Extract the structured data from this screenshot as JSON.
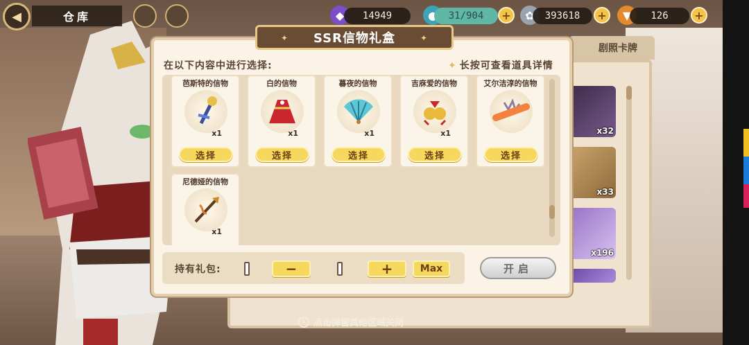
{
  "header": {
    "title": "仓库",
    "resources": [
      {
        "name": "crystal",
        "value": "14949",
        "icon": "crystal-icon"
      },
      {
        "name": "stamina",
        "value": "31/904",
        "icon": "potion-icon"
      },
      {
        "name": "coins",
        "value": "393618",
        "icon": "coin-icon"
      },
      {
        "name": "carrot",
        "value": "126",
        "icon": "carrot-icon"
      }
    ]
  },
  "side_panel": {
    "tab_label": "剧照卡牌",
    "items": [
      {
        "count": "x32"
      },
      {
        "count": "x33"
      },
      {
        "count": "x196"
      }
    ]
  },
  "modal": {
    "title": "SSR信物礼盒",
    "prompt": "在以下内容中进行选择:",
    "hint": "长按可查看道具详情",
    "cards": [
      {
        "name": "芭斯特的信物",
        "qty": "x1",
        "select": "选择",
        "icon": "scepter-icon"
      },
      {
        "name": "白的信物",
        "qty": "x1",
        "select": "选择",
        "icon": "dress-icon"
      },
      {
        "name": "暮夜的信物",
        "qty": "x1",
        "select": "选择",
        "icon": "fan-icon"
      },
      {
        "name": "吉庥爱的信物",
        "qty": "x1",
        "select": "选择",
        "icon": "bell-icon"
      },
      {
        "name": "艾尔洁淳的信物",
        "qty": "x1",
        "select": "选择",
        "icon": "hairpin-icon"
      },
      {
        "name": "尼德娅的信物",
        "qty": "x1",
        "select": "",
        "icon": "spear-icon"
      }
    ],
    "footer": {
      "label": "持有礼包:",
      "minus": "−",
      "plus": "+",
      "max": "Max",
      "open": "开启"
    }
  },
  "close_hint": "点击弹窗其他区域关闭",
  "colors": {
    "accent_yellow": "#f7d85e",
    "modal_bg": "#fbf4e6",
    "title_brown": "#6a4b34"
  }
}
